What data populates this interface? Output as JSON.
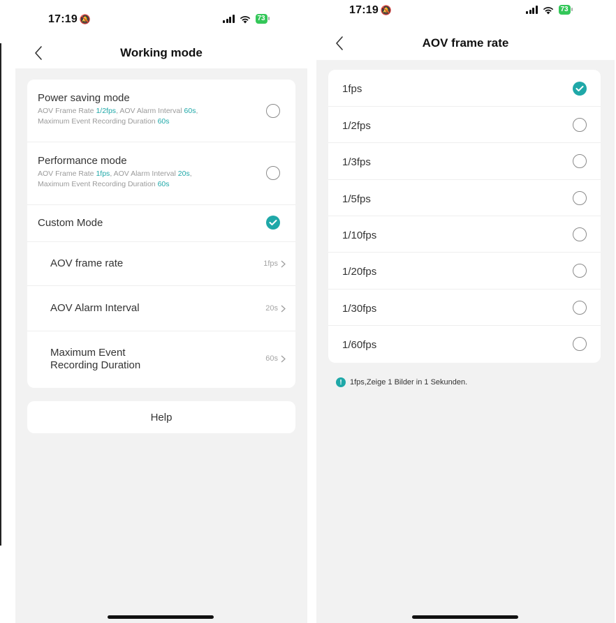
{
  "left": {
    "status": {
      "time": "17:19",
      "battery": "73"
    },
    "nav": {
      "title": "Working mode"
    },
    "modes": [
      {
        "title": "Power saving mode",
        "desc": {
          "frame_rate_label": "AOV Frame Rate ",
          "frame_rate_value": "1/2fps",
          "alarm_label": ", AOV Alarm Interval ",
          "alarm_value": "60s",
          "duration_label": "Maximum Event Recording Duration ",
          "duration_value": "60s",
          "comma": ","
        },
        "selected": false
      },
      {
        "title": "Performance mode",
        "desc": {
          "frame_rate_label": "AOV Frame Rate ",
          "frame_rate_value": "1fps",
          "alarm_label": ", AOV Alarm Interval ",
          "alarm_value": "20s",
          "duration_label": "Maximum Event Recording Duration ",
          "duration_value": "60s",
          "comma": ","
        },
        "selected": false
      },
      {
        "title": "Custom Mode",
        "selected": true
      }
    ],
    "custom_settings": [
      {
        "label": "AOV frame rate",
        "value": "1fps"
      },
      {
        "label": "AOV Alarm Interval",
        "value": "20s"
      },
      {
        "label_line1": "Maximum Event",
        "label_line2": "Recording Duration",
        "value": "60s"
      }
    ],
    "help": {
      "label": "Help"
    }
  },
  "right": {
    "status": {
      "time": "17:19",
      "battery": "73"
    },
    "nav": {
      "title": "AOV frame rate"
    },
    "options": [
      {
        "label": "1fps",
        "selected": true
      },
      {
        "label": "1/2fps",
        "selected": false
      },
      {
        "label": "1/3fps",
        "selected": false
      },
      {
        "label": "1/5fps",
        "selected": false
      },
      {
        "label": "1/10fps",
        "selected": false
      },
      {
        "label": "1/20fps",
        "selected": false
      },
      {
        "label": "1/30fps",
        "selected": false
      },
      {
        "label": "1/60fps",
        "selected": false
      }
    ],
    "info_text": "1fps,Zeige 1 Bilder in 1 Sekunden.",
    "info_icon": "!"
  },
  "colors": {
    "accent": "#1fa8a8",
    "background": "#f2f2f2",
    "battery": "#34c759"
  }
}
